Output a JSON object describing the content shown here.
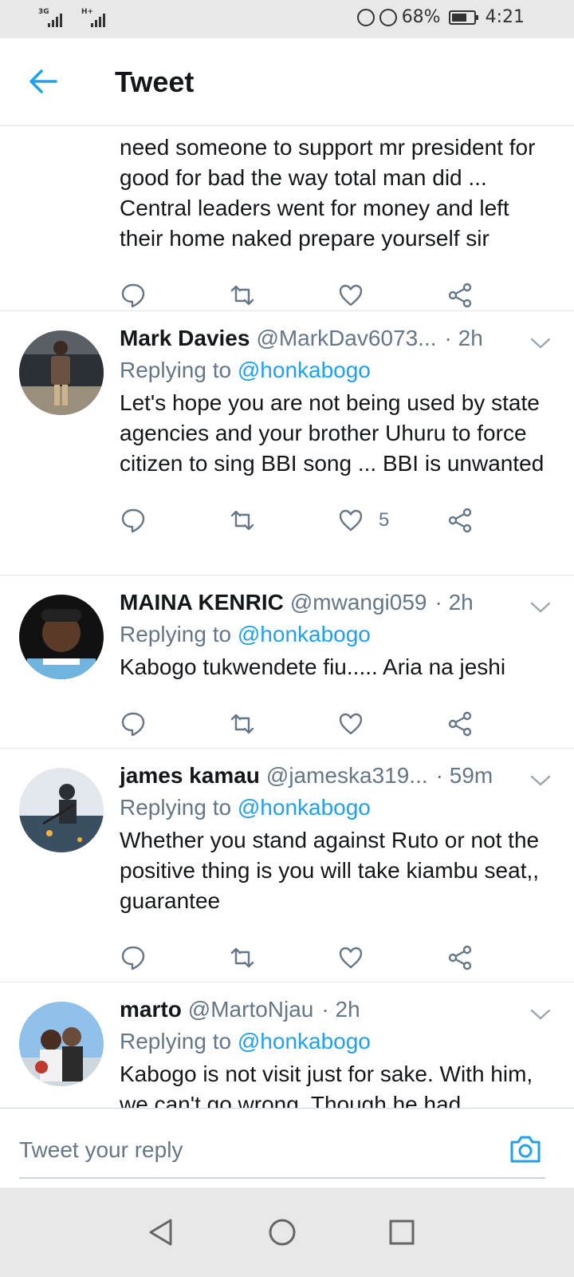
{
  "status_bar": {
    "sim1": "3G",
    "sim2": "H+",
    "battery": "68%",
    "time": "4:21"
  },
  "header": {
    "title": "Tweet"
  },
  "top_tweet": {
    "text": "need someone to support mr president for good for bad the way total man did ... Central leaders went for money and left their home naked prepare yourself sir"
  },
  "replies": [
    {
      "name": "Mark Davies",
      "handle": "@MarkDav6073...",
      "time": "· 2h",
      "replying_prefix": "Replying to ",
      "replying_to": "@honkabogo",
      "text": "Let's hope you are not being used by state agencies and your brother Uhuru to force citizen to sing BBI song ... BBI is unwanted",
      "likes": "5"
    },
    {
      "name": "MAINA KENRIC",
      "handle": "@mwangi059",
      "time": "· 2h",
      "replying_prefix": "Replying to ",
      "replying_to": "@honkabogo",
      "text": "Kabogo tukwendete fiu..... Aria na jeshi",
      "likes": ""
    },
    {
      "name": "james kamau",
      "handle": "@jameska319...",
      "time": "· 59m",
      "replying_prefix": "Replying to ",
      "replying_to": "@honkabogo",
      "text": "Whether you stand against Ruto or not the positive thing is you will take kiambu seat,, guarantee",
      "likes": ""
    },
    {
      "name": "marto",
      "handle": "@MartoNjau",
      "time": "· 2h",
      "replying_prefix": "Replying to ",
      "replying_to": "@honkabogo",
      "text": "Kabogo is not visit just for sake. With him, we can't go wrong. Though he had",
      "likes": ""
    }
  ],
  "reply_bar": {
    "placeholder": "Tweet your reply"
  },
  "colors": {
    "accent": "#1da1f2",
    "text": "#14171a",
    "secondary": "#657786",
    "divider": "#e1e8ed"
  }
}
